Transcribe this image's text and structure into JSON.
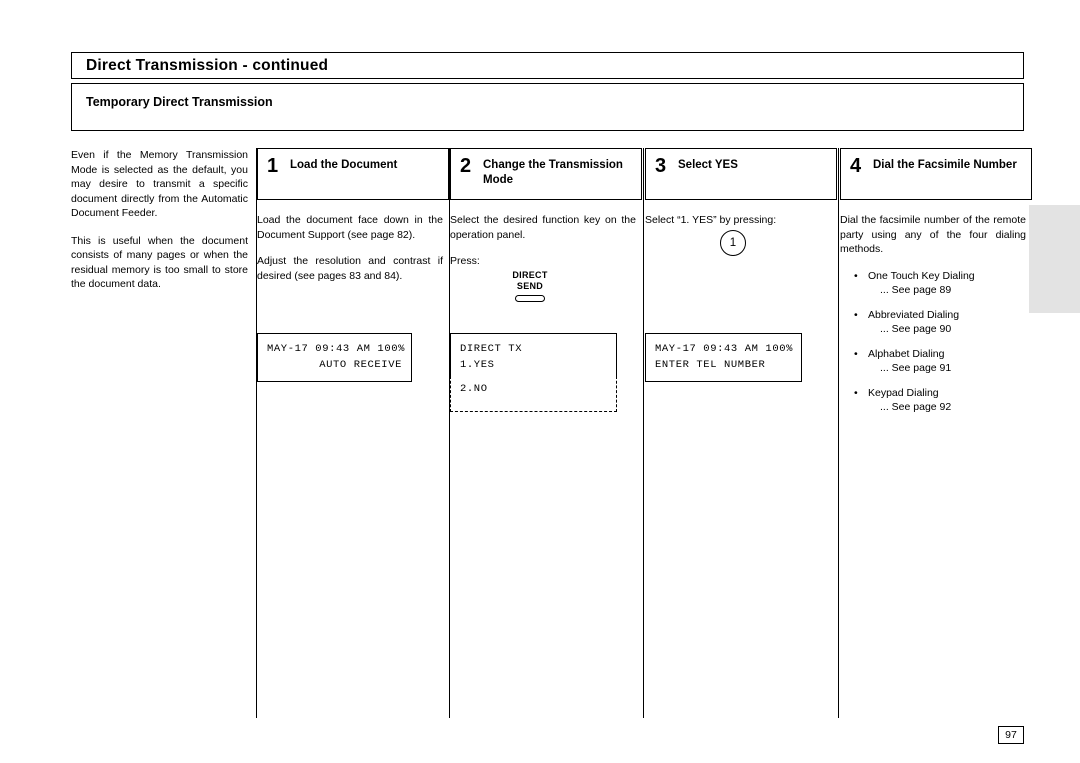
{
  "header": {
    "title": "Direct Transmission - continued",
    "subtitle": "Temporary Direct Transmission"
  },
  "intro": {
    "paragraph1": "Even if the Memory Transmission Mode is selected as the default, you may desire to transmit a specific document directly from the Automatic Document Feeder.",
    "paragraph2": "This is useful when the document consists of many pages or when the residual memory is too small to store the document data."
  },
  "steps": [
    {
      "number": "1",
      "label": "Load the Document",
      "paragraphs": [
        "Load the document face down in the Document Support (see page 82).",
        "Adjust the resolution and contrast if desired (see pages 83 and 84)."
      ],
      "lcd": {
        "line1": "MAY-17 09:43 AM 100%",
        "line2": "AUTO RECEIVE"
      }
    },
    {
      "number": "2",
      "label": "Change the Transmission Mode",
      "paragraphs": [
        "Select the desired function key on the operation panel.",
        "Press:"
      ],
      "key": {
        "line1": "DIRECT",
        "line2": "SEND"
      },
      "lcd": {
        "line1": "DIRECT TX",
        "line2": "1.YES",
        "line3": "2.NO"
      }
    },
    {
      "number": "3",
      "label": "Select YES",
      "paragraphs": [
        "Select “1. YES” by pressing:"
      ],
      "circle": "1",
      "lcd": {
        "line1": "MAY-17 09:43 AM 100%",
        "line2": "ENTER TEL NUMBER"
      }
    },
    {
      "number": "4",
      "label": "Dial the Facsimile Number",
      "paragraphs": [
        "Dial the facsimile number of the remote party using any of the four dialing methods."
      ],
      "bullets": [
        {
          "text": "One Touch Key Dialing",
          "sub": "... See page 89"
        },
        {
          "text": "Abbreviated Dialing",
          "sub": "... See page 90"
        },
        {
          "text": "Alphabet Dialing",
          "sub": "... See page 91"
        },
        {
          "text": "Keypad Dialing",
          "sub": "... See page 92"
        }
      ]
    }
  ],
  "footer": {
    "page_number": "97"
  }
}
